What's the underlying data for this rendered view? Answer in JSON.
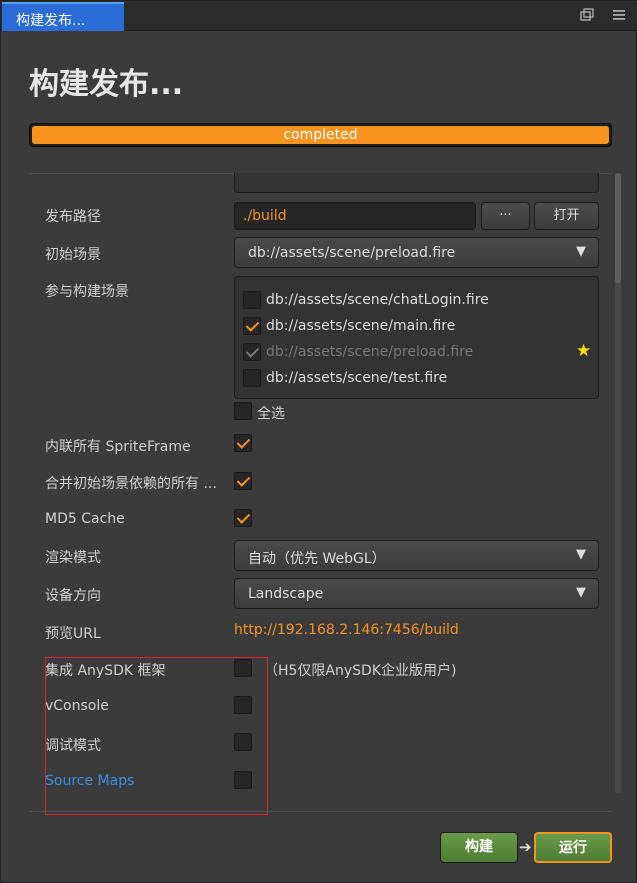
{
  "window": {
    "tab_label": "构建发布...",
    "title": "构建发布..."
  },
  "progress": {
    "label": "completed",
    "fraction": 1.0
  },
  "form": {
    "build_path": {
      "label": "发布路径",
      "value": "./build",
      "browse_label": "···",
      "open_label": "打开"
    },
    "start_scene": {
      "label": "初始场景",
      "value": "db://assets/scene/preload.fire"
    },
    "scenes": {
      "label": "参与构建场景",
      "items": [
        {
          "path": "db://assets/scene/chatLogin.fire",
          "checked": false
        },
        {
          "path": "db://assets/scene/main.fire",
          "checked": true
        },
        {
          "path": "db://assets/scene/preload.fire",
          "checked": true,
          "disabled": true,
          "start_scene": true
        },
        {
          "path": "db://assets/scene/test.fire",
          "checked": false
        }
      ],
      "select_all_label": "全选"
    },
    "inline_spriteframes": {
      "label": "内联所有 SpriteFrame",
      "checked": true
    },
    "merge_start_scene": {
      "label": "合并初始场景依赖的所有 ...",
      "checked": true
    },
    "md5_cache": {
      "label": "MD5 Cache",
      "checked": true
    },
    "render_mode": {
      "label": "渲染模式",
      "value": "自动（优先 WebGL）"
    },
    "orientation": {
      "label": "设备方向",
      "value": "Landscape"
    },
    "preview_url": {
      "label": "预览URL",
      "value": "http://192.168.2.146:7456/build"
    },
    "anysdk": {
      "label": "集成 AnySDK 框架",
      "checked": false,
      "note": "（H5仅限AnySDK企业版用户)"
    },
    "vconsole": {
      "label": "vConsole",
      "checked": false
    },
    "debug_mode": {
      "label": "调试模式",
      "checked": false
    },
    "source_maps": {
      "label": "Source Maps",
      "checked": false
    }
  },
  "footer": {
    "build_label": "构建",
    "run_label": "运行"
  },
  "colors": {
    "accent": "#f7931e",
    "tab_active": "#2a6bd5",
    "link": "#3a8ee6",
    "highlight_box": "#d2282c",
    "button_green": "#5a8a3e"
  }
}
